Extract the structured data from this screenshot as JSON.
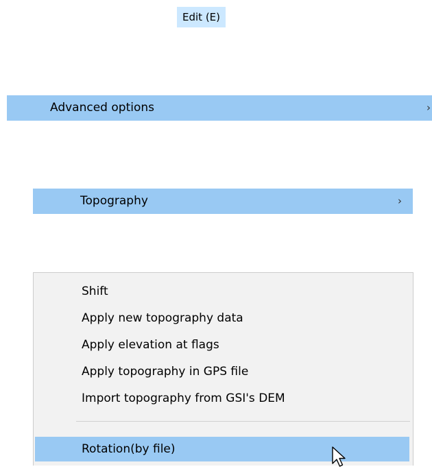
{
  "menu_title": "Edit (E)",
  "advanced": {
    "label": "Advanced options",
    "arrow": "›"
  },
  "topography": {
    "label": "Topography",
    "arrow": "›"
  },
  "submenu": {
    "items": [
      "Shift",
      "Apply new topography data",
      "Apply elevation at flags",
      "Apply topography in GPS file",
      "Import topography from GSI's DEM"
    ],
    "selected": "Rotation(by file)"
  },
  "icons": {
    "cursor": "mouse-pointer-icon"
  },
  "colors": {
    "highlight": "#99c9f3",
    "title_highlight": "#cce8ff",
    "menu_background": "#f2f2f2"
  }
}
